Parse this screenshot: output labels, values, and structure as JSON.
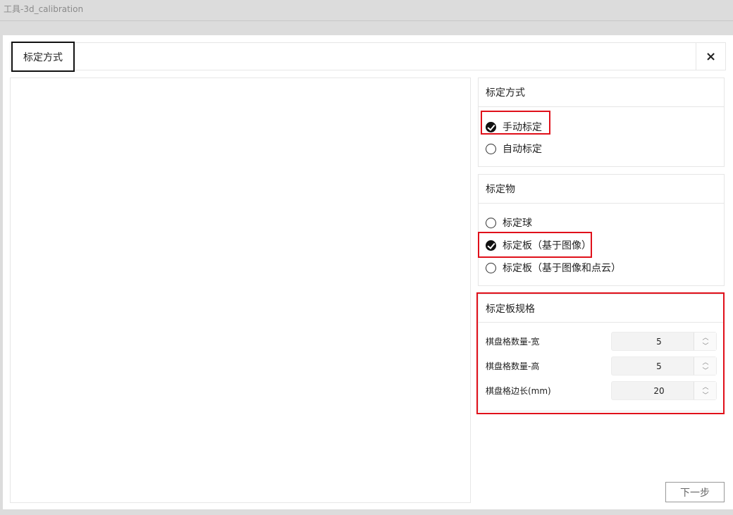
{
  "window": {
    "title": "工具-3d_calibration"
  },
  "dialog": {
    "tab_label": "标定方式",
    "close_icon": "×",
    "next_label": "下一步"
  },
  "method_panel": {
    "title": "标定方式",
    "options": [
      {
        "label": "手动标定",
        "checked": true
      },
      {
        "label": "自动标定",
        "checked": false
      }
    ]
  },
  "object_panel": {
    "title": "标定物",
    "options": [
      {
        "label": "标定球",
        "checked": false
      },
      {
        "label": "标定板（基于图像）",
        "checked": true
      },
      {
        "label": "标定板（基于图像和点云）",
        "checked": false
      }
    ]
  },
  "spec_panel": {
    "title": "标定板规格",
    "fields": [
      {
        "label": "棋盘格数量-宽",
        "value": "5"
      },
      {
        "label": "棋盘格数量-高",
        "value": "5"
      },
      {
        "label": "棋盘格边长(mm)",
        "value": "20"
      }
    ]
  },
  "colors": {
    "highlight": "#e0101a",
    "selected": "#111111"
  }
}
